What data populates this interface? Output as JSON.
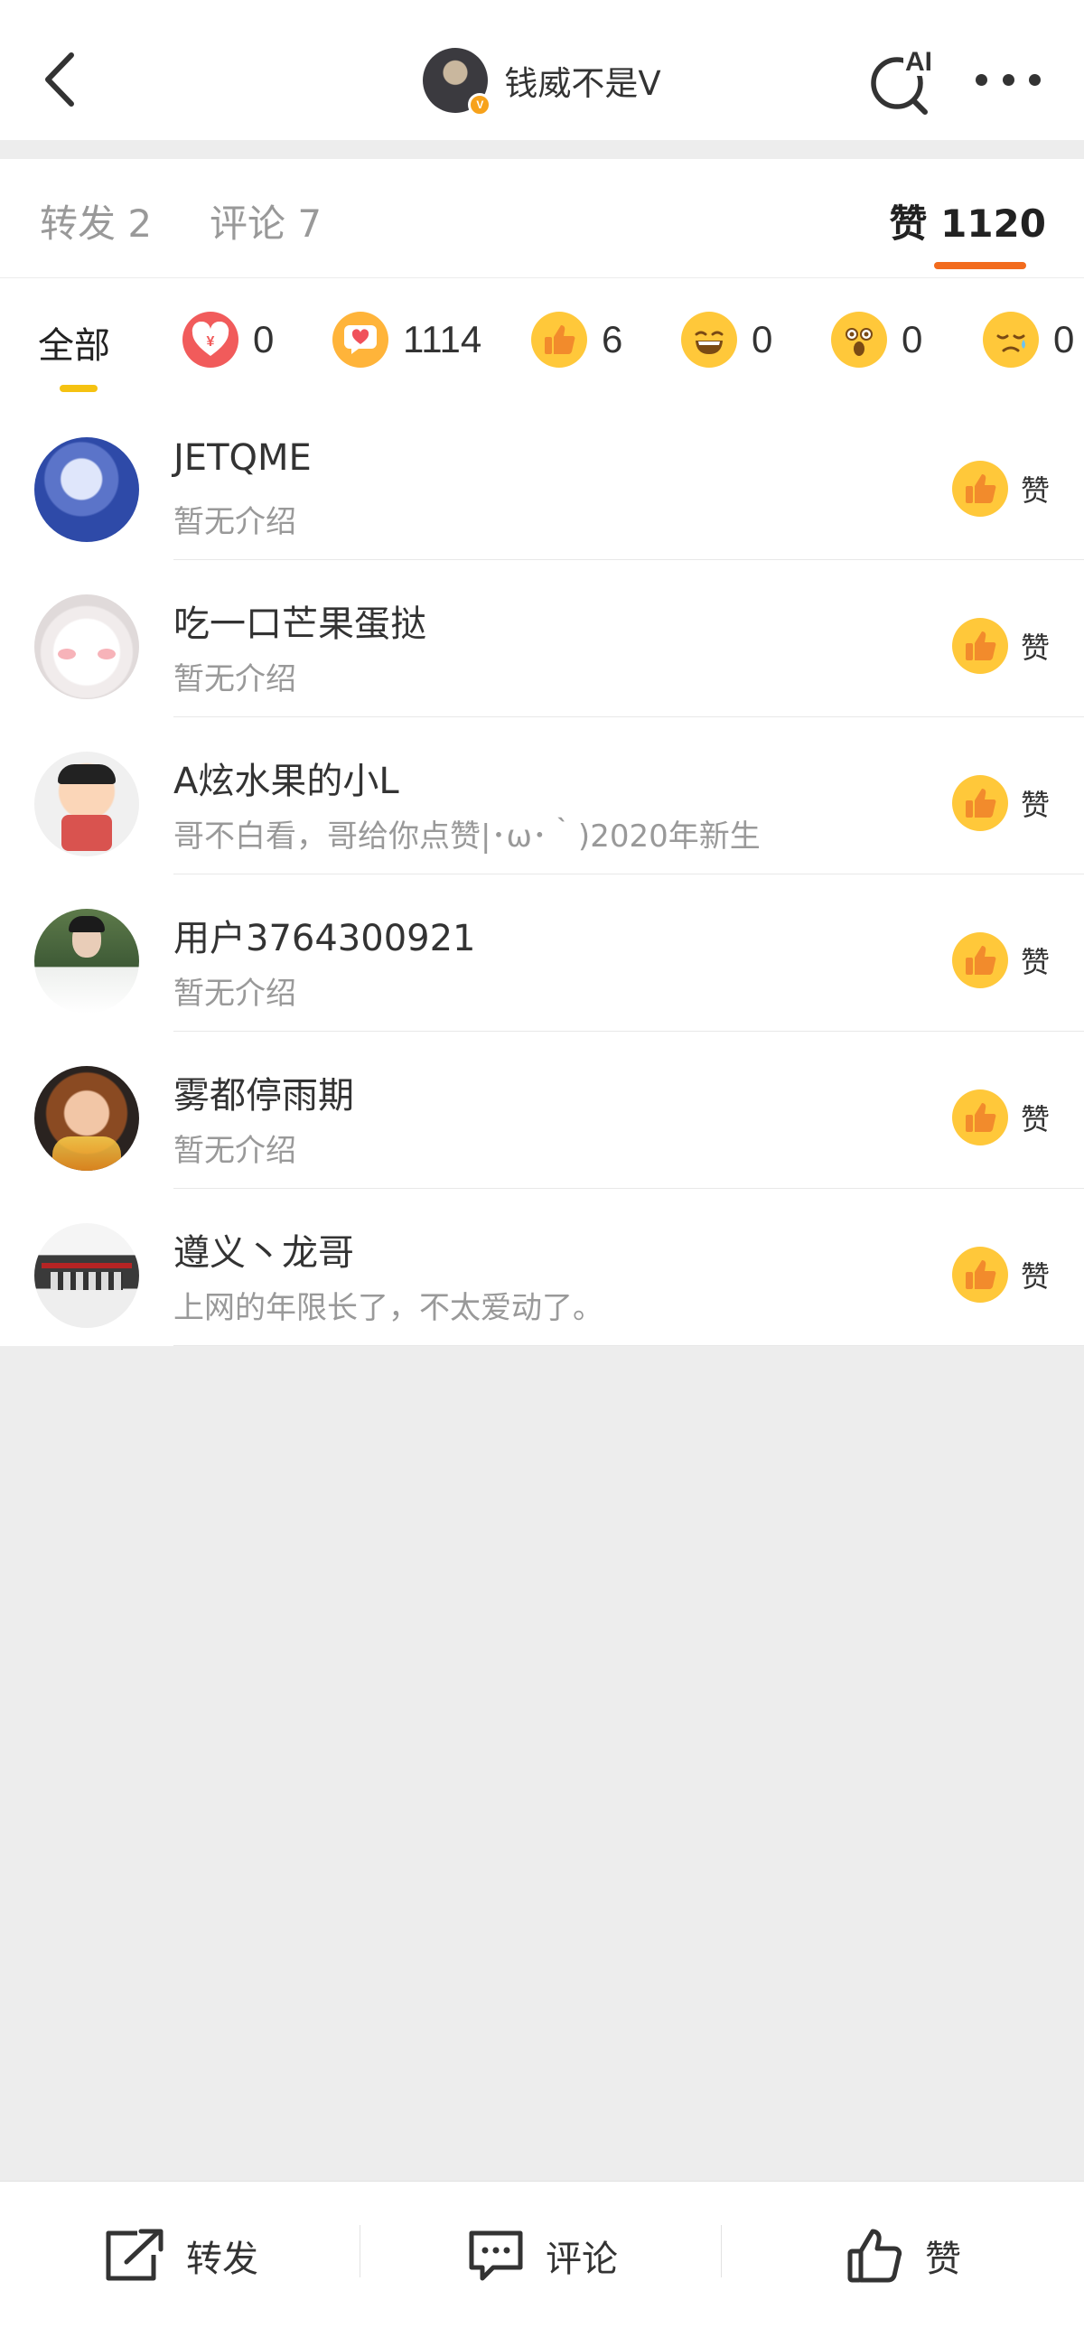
{
  "header": {
    "title": "钱威不是V",
    "back_icon": "back-arrow-icon",
    "ai_search_label": "AI",
    "more_icon": "more-dots-icon"
  },
  "tabs": {
    "repost": "转发 2",
    "comment": "评论 7",
    "like": "赞 1120",
    "active": "like",
    "accent_color": "#f26b1d"
  },
  "reactions": {
    "all_label": "全部",
    "items": [
      {
        "icon": "reward-heart-icon",
        "count": "0"
      },
      {
        "icon": "love-message-icon",
        "count": "1114"
      },
      {
        "icon": "thumbs-up-icon",
        "count": "6"
      },
      {
        "icon": "laugh-icon",
        "count": "0"
      },
      {
        "icon": "surprised-icon",
        "count": "0"
      },
      {
        "icon": "sad-icon",
        "count": "0"
      }
    ]
  },
  "users": [
    {
      "name": "JETQME",
      "desc": "暂无介绍",
      "like_label": "赞"
    },
    {
      "name": "吃一口芒果蛋挞",
      "desc": "暂无介绍",
      "like_label": "赞"
    },
    {
      "name": "A炫水果的小L",
      "desc": "哥不白看，哥给你点赞|･ω･｀)2020年新生",
      "like_label": "赞"
    },
    {
      "name": "用户3764300921",
      "desc": "暂无介绍",
      "like_label": "赞"
    },
    {
      "name": "雾都停雨期",
      "desc": "暂无介绍",
      "like_label": "赞"
    },
    {
      "name": "遵义丶龙哥",
      "desc": "上网的年限长了，不太爱动了。",
      "like_label": "赞"
    }
  ],
  "bottom": {
    "repost": "转发",
    "comment": "评论",
    "like": "赞"
  }
}
